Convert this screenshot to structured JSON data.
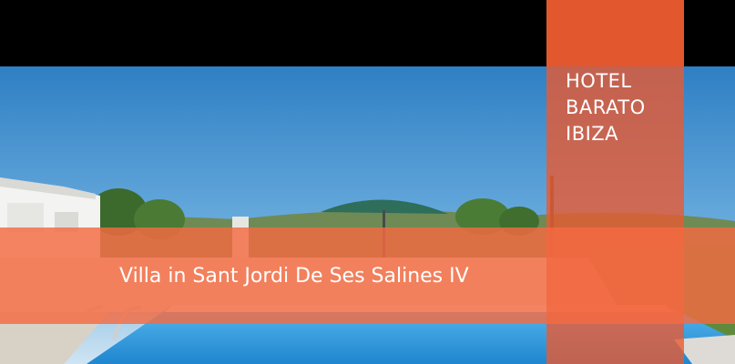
{
  "brand": {
    "lines": [
      "HOTEL",
      "BARATO",
      "IBIZA"
    ]
  },
  "title": "Villa in Sant Jordi De Ses Salines IV",
  "colors": {
    "accent": "#f46a42",
    "accent_dark": "#c94a22",
    "top_band": "#000000",
    "sky": "#3f8fd0",
    "pool": "#1e8fd6"
  }
}
